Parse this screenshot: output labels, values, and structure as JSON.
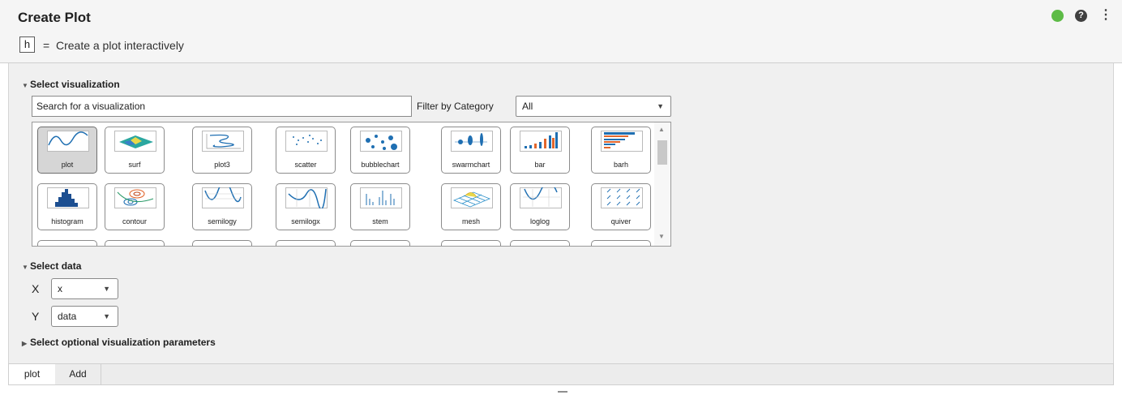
{
  "header": {
    "title": "Create Plot",
    "output_var": "h",
    "equals": "=",
    "description": "Create a plot interactively",
    "status_color": "#5dbb46",
    "help_label": "?",
    "menu_label": "⋮"
  },
  "sections": {
    "visualization": {
      "label": "Select visualization",
      "expanded": true
    },
    "data": {
      "label": "Select data",
      "expanded": true
    },
    "optional": {
      "label": "Select optional visualization parameters",
      "expanded": false
    }
  },
  "search": {
    "value": "Search for a visualization"
  },
  "filter": {
    "label": "Filter by Category",
    "selected": "All"
  },
  "gallery": {
    "items": [
      {
        "label": "plot",
        "icon": "plot-icon",
        "selected": true
      },
      {
        "label": "surf",
        "icon": "surf-icon"
      },
      {
        "label": "plot3",
        "icon": "plot3-icon"
      },
      {
        "label": "scatter",
        "icon": "scatter-icon"
      },
      {
        "label": "bubblechart",
        "icon": "bubblechart-icon"
      },
      {
        "label": "swarmchart",
        "icon": "swarmchart-icon"
      },
      {
        "label": "bar",
        "icon": "bar-icon"
      },
      {
        "label": "barh",
        "icon": "barh-icon"
      },
      {
        "label": "histogram",
        "icon": "histogram-icon"
      },
      {
        "label": "contour",
        "icon": "contour-icon"
      },
      {
        "label": "semilogy",
        "icon": "semilogy-icon"
      },
      {
        "label": "semilogx",
        "icon": "semilogx-icon"
      },
      {
        "label": "stem",
        "icon": "stem-icon"
      },
      {
        "label": "mesh",
        "icon": "mesh-icon"
      },
      {
        "label": "loglog",
        "icon": "loglog-icon"
      },
      {
        "label": "quiver",
        "icon": "quiver-icon"
      }
    ]
  },
  "data_select": {
    "x_label": "X",
    "x_value": "x",
    "y_label": "Y",
    "y_value": "data"
  },
  "tabs": [
    {
      "label": "plot",
      "active": true
    },
    {
      "label": "Add",
      "active": false
    }
  ]
}
